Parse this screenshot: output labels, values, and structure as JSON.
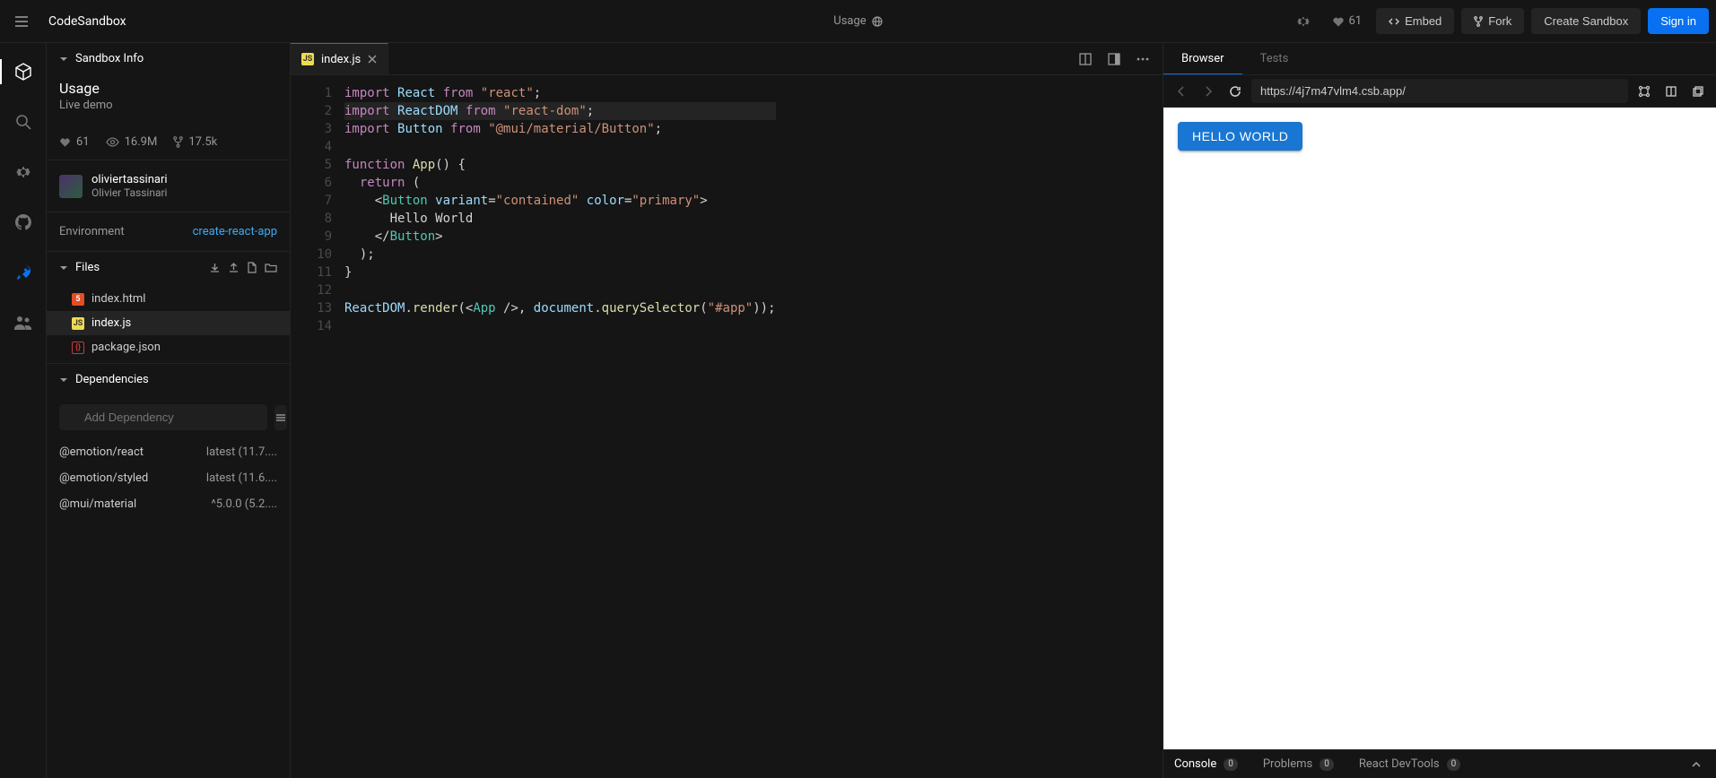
{
  "header": {
    "brand": "CodeSandbox",
    "title": "Usage",
    "like_count": "61",
    "embed_label": "Embed",
    "fork_label": "Fork",
    "create_label": "Create Sandbox",
    "signin_label": "Sign in"
  },
  "sidebar": {
    "info_header": "Sandbox Info",
    "title": "Usage",
    "subtitle": "Live demo",
    "stats": {
      "likes": "61",
      "views": "16.9M",
      "forks": "17.5k"
    },
    "author": {
      "handle": "oliviertassinari",
      "name": "Olivier Tassinari"
    },
    "env_label": "Environment",
    "env_value": "create-react-app",
    "files_header": "Files",
    "files": [
      {
        "name": "index.html",
        "type": "html"
      },
      {
        "name": "index.js",
        "type": "js"
      },
      {
        "name": "package.json",
        "type": "json"
      }
    ],
    "deps_header": "Dependencies",
    "deps_placeholder": "Add Dependency",
    "deps": [
      {
        "name": "@emotion/react",
        "version": "latest (11.7...."
      },
      {
        "name": "@emotion/styled",
        "version": "latest (11.6...."
      },
      {
        "name": "@mui/material",
        "version": "^5.0.0 (5.2...."
      }
    ]
  },
  "editor": {
    "tab_name": "index.js",
    "code": [
      {
        "t": "import",
        "rest": " React from \"react\";"
      },
      {
        "t": "import",
        "rest": " ReactDOM from \"react-dom\";"
      },
      {
        "t": "import",
        "rest": " Button from \"@mui/material/Button\";"
      },
      "",
      "function App() {",
      "  return (",
      "    <Button variant=\"contained\" color=\"primary\">",
      "      Hello World",
      "    </Button>",
      "  );",
      "}",
      "",
      "ReactDOM.render(<App />, document.querySelector(\"#app\"));",
      ""
    ]
  },
  "preview": {
    "tabs": [
      "Browser",
      "Tests"
    ],
    "url": "https://4j7m47vlm4.csb.app/",
    "button_text": "HELLO WORLD"
  },
  "console": {
    "tabs": [
      {
        "label": "Console",
        "count": "0"
      },
      {
        "label": "Problems",
        "count": "0"
      },
      {
        "label": "React DevTools",
        "count": "0"
      }
    ]
  }
}
